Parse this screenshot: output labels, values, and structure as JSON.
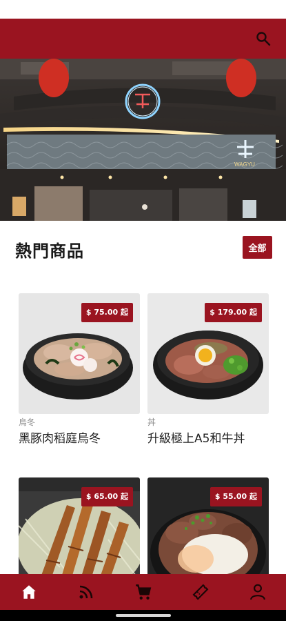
{
  "colors": {
    "brand": "#9a1420",
    "background": "#ffffff"
  },
  "appbar": {
    "search_icon": "search-icon"
  },
  "hero": {
    "sign_text": "WAGYU"
  },
  "section": {
    "title": "熱門商品",
    "all_label": "全部"
  },
  "products": [
    {
      "price": "$ 75.00 起",
      "category": "烏冬",
      "name": "黑豚肉稻庭烏冬"
    },
    {
      "price": "$ 179.00 起",
      "category": "丼",
      "name": "升級極上A5和牛丼"
    },
    {
      "price": "$ 65.00 起",
      "category": "",
      "name": ""
    },
    {
      "price": "$ 55.00 起",
      "category": "",
      "name": ""
    }
  ],
  "bottom_nav": [
    {
      "icon": "home-icon"
    },
    {
      "icon": "rss-icon"
    },
    {
      "icon": "cart-icon"
    },
    {
      "icon": "ticket-icon"
    },
    {
      "icon": "user-icon"
    }
  ]
}
